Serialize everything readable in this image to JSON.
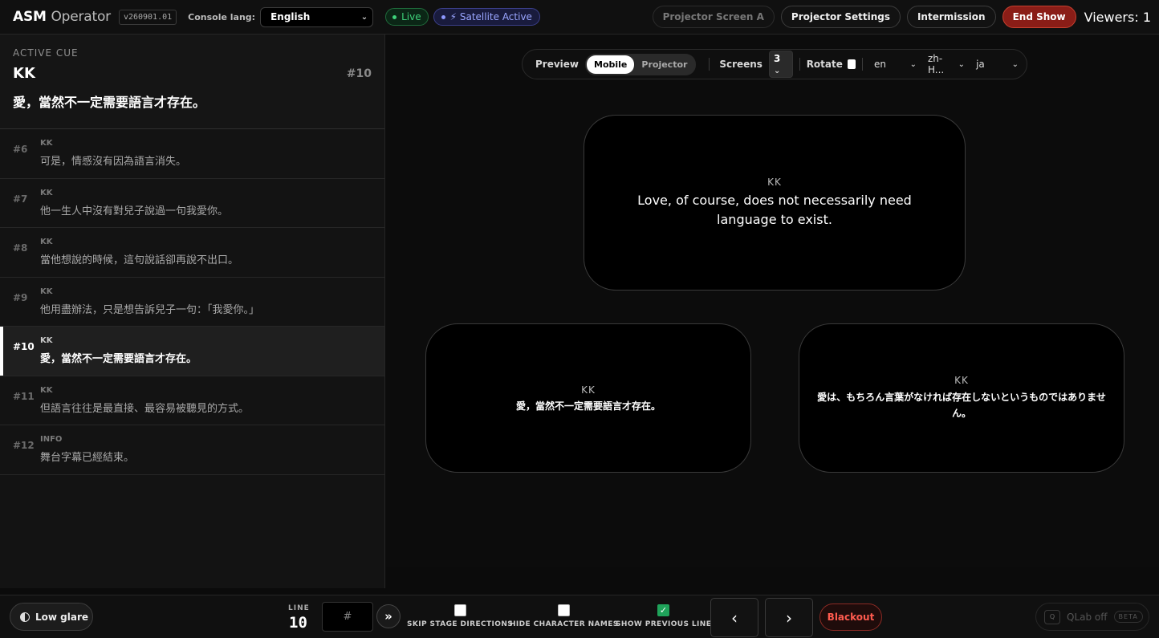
{
  "header": {
    "brand_bold": "ASM",
    "brand_light": "Operator",
    "version": "v260901.01",
    "console_lang_label": "Console lang:",
    "console_lang_value": "English",
    "live_label": "Live",
    "satellite_label": "⚡ Satellite Active",
    "buttons": {
      "projector_screen": "Projector Screen A",
      "projector_settings": "Projector Settings",
      "intermission": "Intermission",
      "end_show": "End Show"
    },
    "viewers": "Viewers: 1"
  },
  "sidebar": {
    "active_label": "ACTIVE CUE",
    "active_char": "KK",
    "active_num": "#10",
    "active_text": "愛，當然不一定需要語言才存在。",
    "cues": [
      {
        "num": "#6",
        "char": "KK",
        "text": "可是，情感沒有因為語言消失。"
      },
      {
        "num": "#7",
        "char": "KK",
        "text": "他一生人中沒有對兒子說過一句我愛你。"
      },
      {
        "num": "#8",
        "char": "KK",
        "text": "當他想說的時候，這句說話卻再說不出口。"
      },
      {
        "num": "#9",
        "char": "KK",
        "text": "他用盡辦法，只是想告訴兒子一句：「我愛你。」"
      },
      {
        "num": "#10",
        "char": "KK",
        "text": "愛，當然不一定需要語言才存在。"
      },
      {
        "num": "#11",
        "char": "KK",
        "text": "但語言往往是最直接、最容易被聽見的方式。"
      },
      {
        "num": "#12",
        "char": "INFO",
        "text": "舞台字幕已經結束。"
      }
    ]
  },
  "preview": {
    "label": "Preview",
    "mode_mobile": "Mobile",
    "mode_projector": "Projector",
    "screens_label": "Screens",
    "screens_value": "3",
    "rotate_label": "Rotate",
    "langs": [
      "en",
      "zh-H...",
      "ja"
    ],
    "screens": [
      {
        "char": "KK",
        "text": "Love, of course, does not necessarily need language to exist."
      },
      {
        "char": "KK",
        "text": "愛，當然不一定需要語言才存在。"
      },
      {
        "char": "KK",
        "text": "愛は、もちろん言葉がなければ存在しないというものではありません。"
      }
    ]
  },
  "footer": {
    "low_glare": "Low glare",
    "line_label": "LINE",
    "line_value": "10",
    "line_input_placeholder": "#",
    "go_icon": "»",
    "skip_stage": "SKIP STAGE DIRECTIONS",
    "hide_names": "HIDE CHARACTER NAMES",
    "show_previous": "SHOW PREVIOUS LINE",
    "prev_icon": "‹",
    "next_icon": "›",
    "blackout": "Blackout",
    "qlab_icon": "Q",
    "qlab": "QLab off",
    "beta": "BETA"
  }
}
